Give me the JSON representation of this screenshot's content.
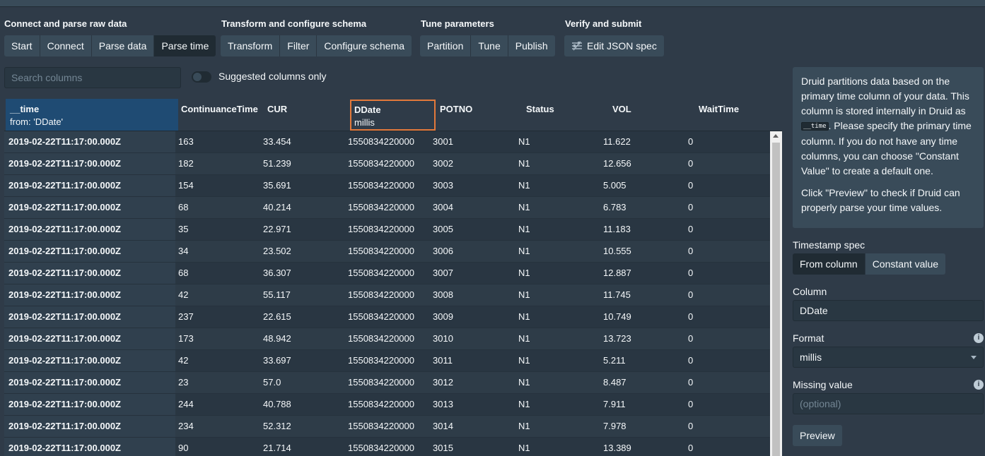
{
  "steps": {
    "connect": {
      "title": "Connect and parse raw data",
      "buttons": [
        "Start",
        "Connect",
        "Parse data",
        "Parse time"
      ],
      "active": 3
    },
    "transform": {
      "title": "Transform and configure schema",
      "buttons": [
        "Transform",
        "Filter",
        "Configure schema"
      ]
    },
    "tune": {
      "title": "Tune parameters",
      "buttons": [
        "Partition",
        "Tune",
        "Publish"
      ]
    },
    "verify": {
      "title": "Verify and submit",
      "json_button": "Edit JSON spec",
      "json_icon": "settings-sliders-icon"
    }
  },
  "search": {
    "placeholder": "Search columns"
  },
  "suggested_toggle": {
    "label": "Suggested columns only",
    "on": false
  },
  "table": {
    "time_column": {
      "name": "__time",
      "source": "from: 'DDate'"
    },
    "columns": [
      "ContinuanceTime",
      "CUR",
      "DDate",
      "POTNO",
      "Status",
      "VOL",
      "WaitTime"
    ],
    "selected_column": {
      "name": "DDate",
      "format": "millis"
    },
    "rows": [
      {
        "time": "2019-02-22T11:17:00.000Z",
        "values": [
          "163",
          "33.454",
          "1550834220000",
          "3001",
          "N1",
          "11.622",
          "0"
        ]
      },
      {
        "time": "2019-02-22T11:17:00.000Z",
        "values": [
          "182",
          "51.239",
          "1550834220000",
          "3002",
          "N1",
          "12.656",
          "0"
        ]
      },
      {
        "time": "2019-02-22T11:17:00.000Z",
        "values": [
          "154",
          "35.691",
          "1550834220000",
          "3003",
          "N1",
          "5.005",
          "0"
        ]
      },
      {
        "time": "2019-02-22T11:17:00.000Z",
        "values": [
          "68",
          "40.214",
          "1550834220000",
          "3004",
          "N1",
          "6.783",
          "0"
        ]
      },
      {
        "time": "2019-02-22T11:17:00.000Z",
        "values": [
          "35",
          "22.971",
          "1550834220000",
          "3005",
          "N1",
          "11.183",
          "0"
        ]
      },
      {
        "time": "2019-02-22T11:17:00.000Z",
        "values": [
          "34",
          "23.502",
          "1550834220000",
          "3006",
          "N1",
          "10.555",
          "0"
        ]
      },
      {
        "time": "2019-02-22T11:17:00.000Z",
        "values": [
          "68",
          "36.307",
          "1550834220000",
          "3007",
          "N1",
          "12.887",
          "0"
        ]
      },
      {
        "time": "2019-02-22T11:17:00.000Z",
        "values": [
          "42",
          "55.117",
          "1550834220000",
          "3008",
          "N1",
          "11.745",
          "0"
        ]
      },
      {
        "time": "2019-02-22T11:17:00.000Z",
        "values": [
          "237",
          "22.615",
          "1550834220000",
          "3009",
          "N1",
          "10.749",
          "0"
        ]
      },
      {
        "time": "2019-02-22T11:17:00.000Z",
        "values": [
          "173",
          "48.942",
          "1550834220000",
          "3010",
          "N1",
          "13.723",
          "0"
        ]
      },
      {
        "time": "2019-02-22T11:17:00.000Z",
        "values": [
          "42",
          "33.697",
          "1550834220000",
          "3011",
          "N1",
          "5.211",
          "0"
        ]
      },
      {
        "time": "2019-02-22T11:17:00.000Z",
        "values": [
          "23",
          "57.0",
          "1550834220000",
          "3012",
          "N1",
          "8.487",
          "0"
        ]
      },
      {
        "time": "2019-02-22T11:17:00.000Z",
        "values": [
          "244",
          "40.788",
          "1550834220000",
          "3013",
          "N1",
          "7.911",
          "0"
        ]
      },
      {
        "time": "2019-02-22T11:17:00.000Z",
        "values": [
          "234",
          "52.312",
          "1550834220000",
          "3014",
          "N1",
          "7.978",
          "0"
        ]
      },
      {
        "time": "2019-02-22T11:17:00.000Z",
        "values": [
          "90",
          "21.714",
          "1550834220000",
          "3015",
          "N1",
          "13.389",
          "0"
        ]
      }
    ]
  },
  "side_panel": {
    "info_part1": "Druid partitions data based on the primary time column of your data. This column is stored internally in Druid as ",
    "info_code": "__time",
    "info_part2": ". Please specify the primary time column. If you do not have any time columns, you can choose \"Constant Value\" to create a default one.",
    "info_para2": "Click \"Preview\" to check if Druid can properly parse your time values.",
    "timestamp_spec_label": "Timestamp spec",
    "timestamp_options": [
      "From column",
      "Constant value"
    ],
    "timestamp_active": 0,
    "column_label": "Column",
    "column_value": "DDate",
    "format_label": "Format",
    "format_value": "millis",
    "missing_label": "Missing value",
    "missing_placeholder": "(optional)",
    "info_icon": "i",
    "preview_button": "Preview"
  },
  "colors": {
    "accent_orange": "#e3793b",
    "time_column_blue": "#1f4b73",
    "background": "#2f3b48"
  }
}
